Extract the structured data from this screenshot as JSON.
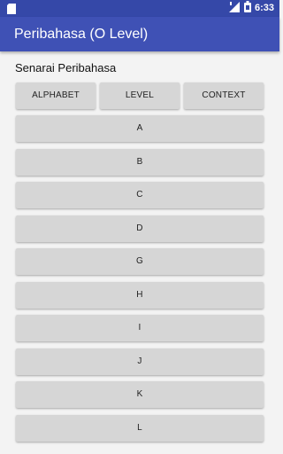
{
  "status_bar": {
    "time": "6:33",
    "icons": [
      "sd-card-icon",
      "signal-icon",
      "battery-icon"
    ]
  },
  "app_bar": {
    "title": "Peribahasa (O Level)",
    "background": "#3f51b5",
    "status_background": "#3548a8"
  },
  "main": {
    "subtitle": "Senarai Peribahasa",
    "tabs": [
      {
        "label": "ALPHABET"
      },
      {
        "label": "LEVEL"
      },
      {
        "label": "CONTEXT"
      }
    ],
    "items": [
      {
        "label": "A"
      },
      {
        "label": "B"
      },
      {
        "label": "C"
      },
      {
        "label": "D"
      },
      {
        "label": "G"
      },
      {
        "label": "H"
      },
      {
        "label": "I"
      },
      {
        "label": "J"
      },
      {
        "label": "K"
      },
      {
        "label": "L"
      }
    ]
  }
}
